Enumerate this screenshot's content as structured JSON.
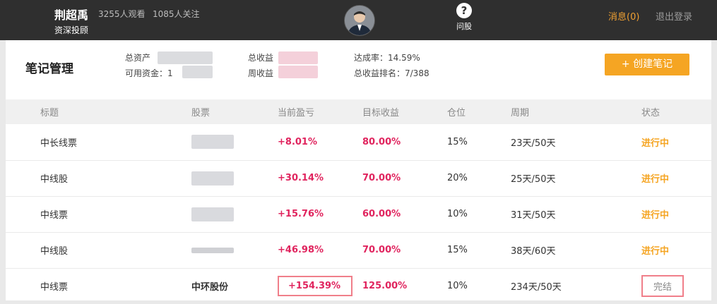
{
  "header": {
    "user_name": "荆超禹",
    "user_role": "资深投顾",
    "views": "3255人观看",
    "follows": "1085人关注",
    "ask_icon": "?",
    "ask_label": "问股",
    "messages": "消息(0)",
    "logout": "退出登录"
  },
  "panel": {
    "title": "笔记管理",
    "total_assets_label": "总资产",
    "available_funds_label": "可用资金：1",
    "total_profit_label": "总收益",
    "weekly_profit_label": "周收益",
    "achievement_rate": "达成率：14.59%",
    "profit_rank": "总收益排名：7/388",
    "create_button": "+ 创建笔记"
  },
  "table": {
    "headers": {
      "title": "标题",
      "stock": "股票",
      "current_pnl": "当前盈亏",
      "target": "目标收益",
      "position": "仓位",
      "period": "周期",
      "status": "状态"
    },
    "rows": [
      {
        "title": "中长线票",
        "stock": "",
        "current_pnl": "+8.01%",
        "target": "80.00%",
        "position": "15%",
        "period": "23天/50天",
        "status": "进行中"
      },
      {
        "title": "中线股",
        "stock": "",
        "current_pnl": "+30.14%",
        "target": "70.00%",
        "position": "20%",
        "period": "25天/50天",
        "status": "进行中"
      },
      {
        "title": "中线票",
        "stock": "",
        "current_pnl": "+15.76%",
        "target": "60.00%",
        "position": "10%",
        "period": "31天/50天",
        "status": "进行中"
      },
      {
        "title": "中线股",
        "stock": "",
        "current_pnl": "+46.98%",
        "target": "70.00%",
        "position": "15%",
        "period": "38天/60天",
        "status": "进行中"
      },
      {
        "title": "中线票",
        "stock": "中环股份",
        "current_pnl": "+154.39%",
        "target": "125.00%",
        "position": "10%",
        "period": "234天/50天",
        "status": "完结"
      }
    ]
  },
  "colors": {
    "topbar": "#2f2f2f",
    "accent_orange": "#f5a523",
    "profit_red": "#e0245e",
    "highlight_border": "#f07f8a"
  }
}
